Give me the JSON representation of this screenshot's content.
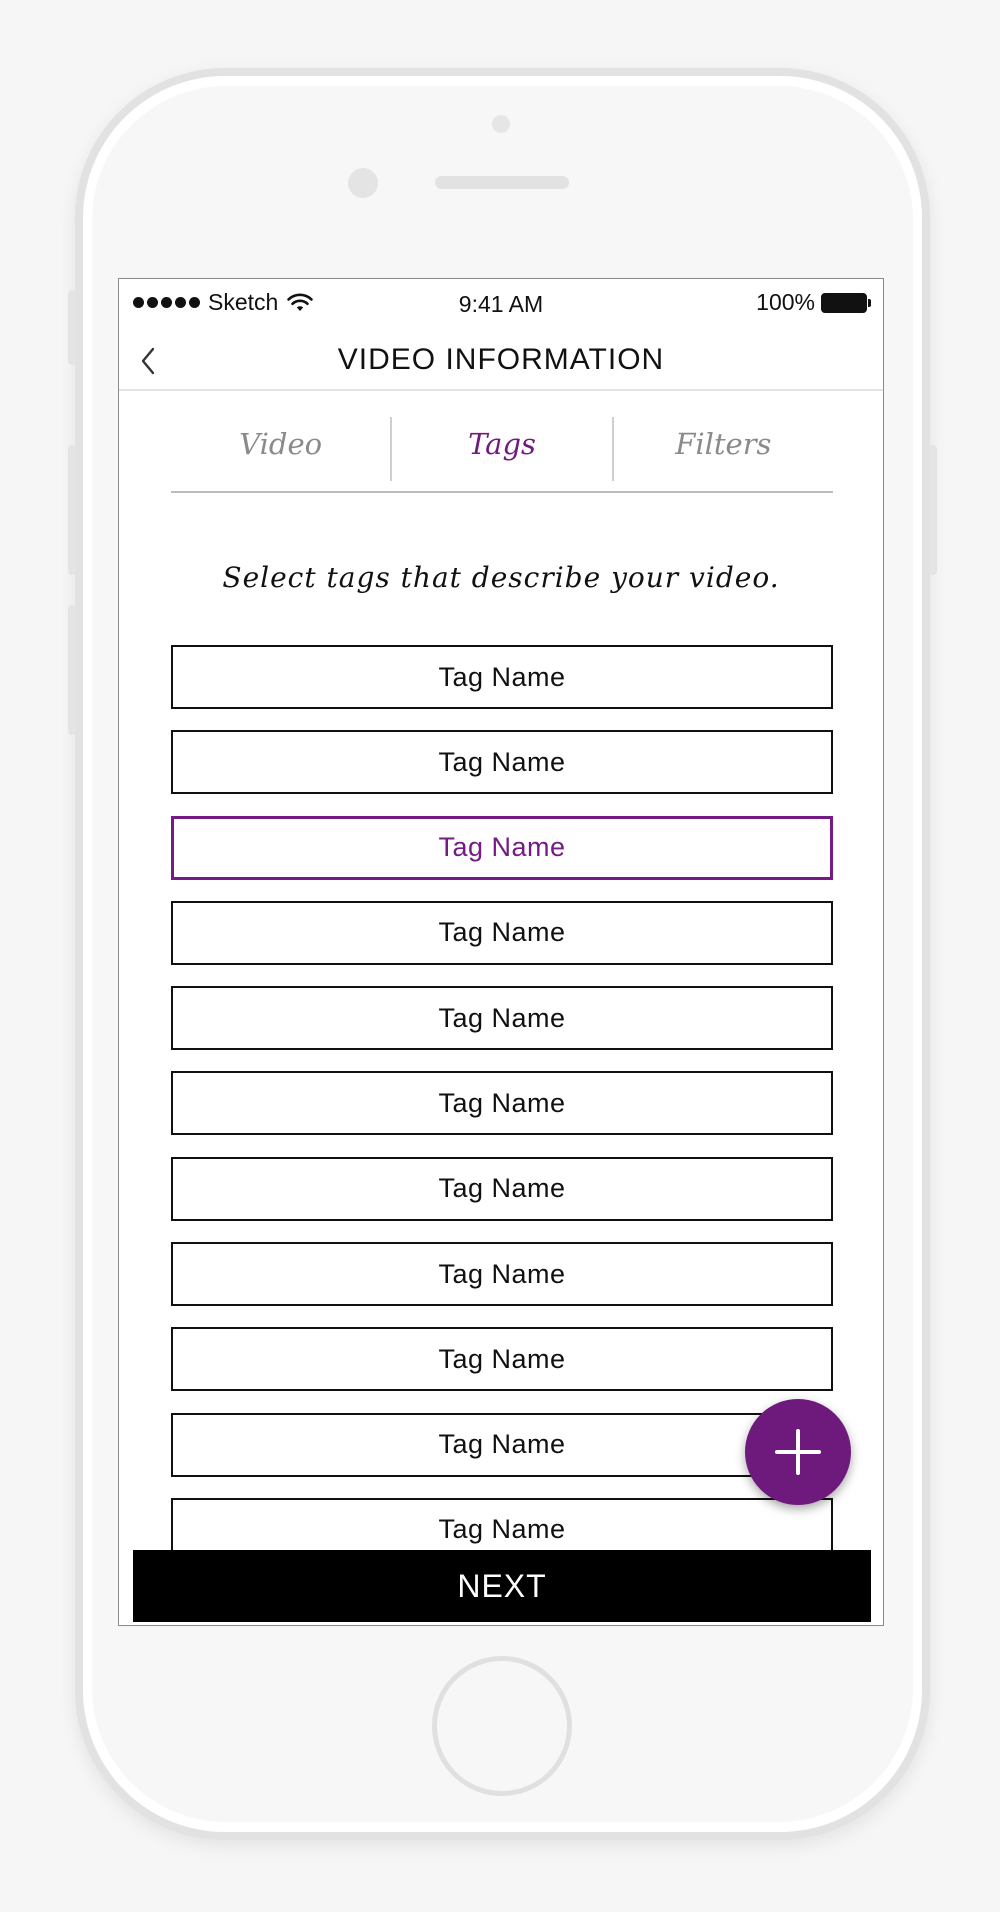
{
  "status_bar": {
    "carrier": "Sketch",
    "time": "9:41 AM",
    "battery": "100%"
  },
  "nav": {
    "title": "VIDEO INFORMATION"
  },
  "tabs": [
    {
      "label": "Video",
      "active": false
    },
    {
      "label": "Tags",
      "active": true
    },
    {
      "label": "Filters",
      "active": false
    }
  ],
  "prompt": "Select tags that describe your video.",
  "tags": [
    {
      "label": "Tag Name"
    },
    {
      "label": "Tag Name"
    },
    {
      "label": "Tag Name",
      "selected": true
    },
    {
      "label": "Tag Name"
    },
    {
      "label": "Tag Name"
    },
    {
      "label": "Tag Name"
    },
    {
      "label": "Tag Name"
    },
    {
      "label": "Tag Name"
    },
    {
      "label": "Tag Name"
    },
    {
      "label": "Tag Name"
    },
    {
      "label": "Tag Name"
    }
  ],
  "fab": {
    "icon": "plus-icon"
  },
  "next_button": "NEXT",
  "colors": {
    "accent": "#701b7e",
    "next_background": "#000000"
  }
}
